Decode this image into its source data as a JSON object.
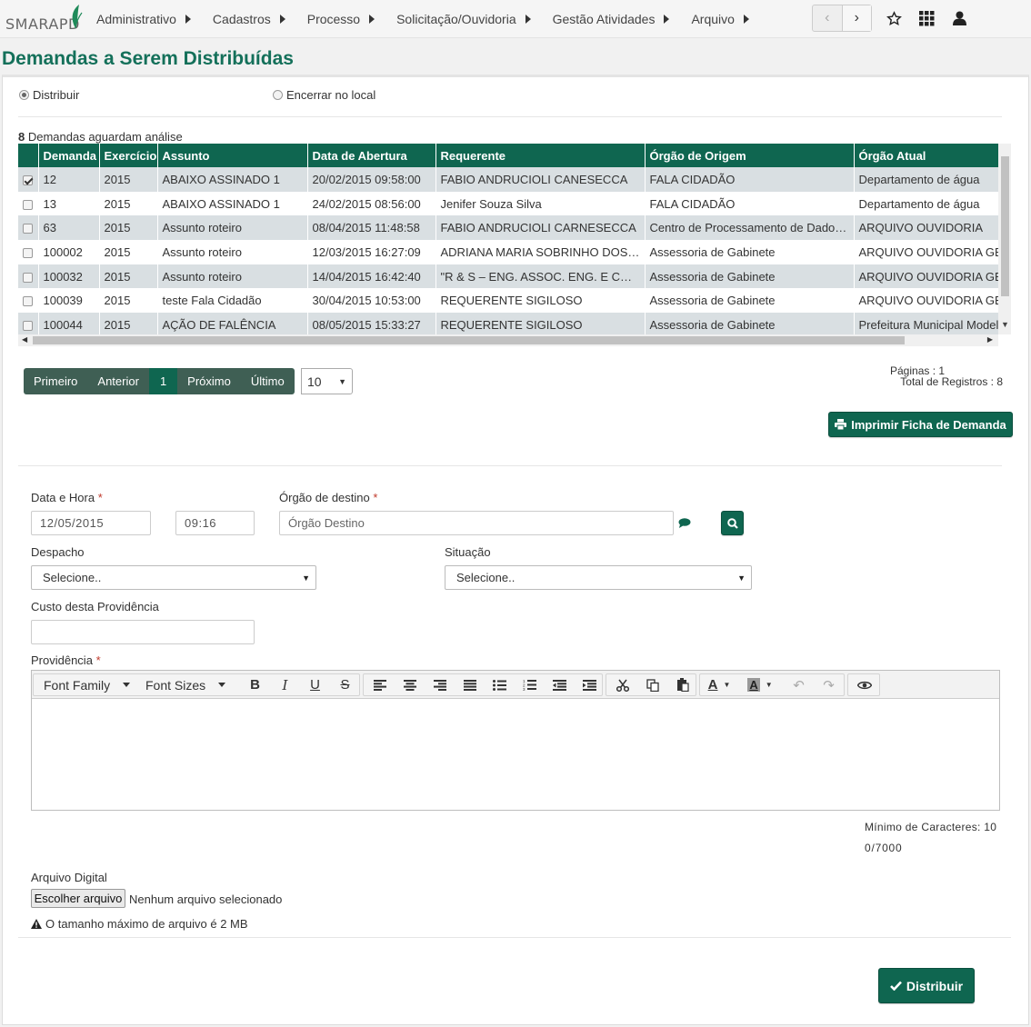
{
  "nav": {
    "logo": "SMARAPD",
    "menu": [
      "Administrativo",
      "Cadastros",
      "Processo",
      "Solicitação/Ouvidoria",
      "Gestão Atividades",
      "Arquivo"
    ]
  },
  "page": {
    "title": "Demandas a Serem Distribuídas"
  },
  "mode": {
    "options": [
      "Distribuir",
      "Encerrar no local"
    ],
    "selected": 0
  },
  "table": {
    "count": "8",
    "count_suffix": " Demandas aguardam análise",
    "columns": [
      "Demanda",
      "Exercício",
      "Assunto",
      "Data de Abertura",
      "Requerente",
      "Órgão de Origem",
      "Órgão Atual"
    ],
    "rows": [
      {
        "checked": true,
        "cells": [
          "12",
          "2015",
          "ABAIXO ASSINADO 1",
          "20/02/2015 09:58:00",
          "FABIO ANDRUCIOLI CANESECCA",
          "FALA CIDADÃO",
          "Departamento de água"
        ]
      },
      {
        "checked": false,
        "cells": [
          "13",
          "2015",
          "ABAIXO ASSINADO 1",
          "24/02/2015 08:56:00",
          "Jenifer Souza Silva",
          "FALA CIDADÃO",
          "Departamento de água"
        ]
      },
      {
        "checked": false,
        "cells": [
          "63",
          "2015",
          "Assunto roteiro",
          "08/04/2015 11:48:58",
          "FABIO ANDRUCIOLI CARNESECCA",
          "Centro de Processamento de Dados…",
          "ARQUIVO OUVIDORIA"
        ]
      },
      {
        "checked": false,
        "cells": [
          "100002",
          "2015",
          "Assunto roteiro",
          "12/03/2015 16:27:09",
          "ADRIANA MARIA SOBRINHO DOS SA…",
          "Assessoria de Gabinete",
          "ARQUIVO OUVIDORIA GERAL"
        ]
      },
      {
        "checked": false,
        "cells": [
          "100032",
          "2015",
          "Assunto roteiro",
          "14/04/2015 16:42:40",
          "\"R & S – ENG. ASSOC. ENG. E COME…",
          "Assessoria de Gabinete",
          "ARQUIVO OUVIDORIA GERAL"
        ]
      },
      {
        "checked": false,
        "cells": [
          "100039",
          "2015",
          "teste Fala Cidadão",
          "30/04/2015 10:53:00",
          "REQUERENTE SIGILOSO",
          "Assessoria de Gabinete",
          "ARQUIVO OUVIDORIA GERAL"
        ]
      },
      {
        "checked": false,
        "cells": [
          "100044",
          "2015",
          "AÇÃO DE FALÊNCIA",
          "08/05/2015 15:33:27",
          "REQUERENTE SIGILOSO",
          "Assessoria de Gabinete",
          "Prefeitura Municipal Modelo"
        ]
      }
    ]
  },
  "pager": {
    "first": "Primeiro",
    "prev": "Anterior",
    "current": "1",
    "next": "Próximo",
    "last": "Último",
    "page_size": "10",
    "pages_label": "Páginas : 1",
    "total_label": "Total de Registros : 8"
  },
  "print_button": "Imprimir Ficha de Demanda",
  "form": {
    "date_label": "Data e Hora",
    "date_value": "12/05/2015",
    "time_value": "09:16",
    "dest_label": "Órgão de destino",
    "dest_placeholder": "Órgão Destino",
    "despacho_label": "Despacho",
    "despacho_value": "Selecione..",
    "situacao_label": "Situação",
    "situacao_value": "Selecione..",
    "custo_label": "Custo desta Providência",
    "custo_value": "",
    "providencia_label": "Providência",
    "font_family": "Font Family",
    "font_sizes": "Font Sizes",
    "min_chars": "Mínimo de Caracteres: 10",
    "char_count": "0/7000",
    "file_label": "Arquivo Digital",
    "file_button": "Escolher arquivo",
    "file_status": "Nenhum arquivo selecionado",
    "file_warning": "O tamanho máximo de arquivo é 2 MB",
    "required_mark": "*"
  },
  "submit_button": "Distribuir",
  "colors": {
    "brand": "#0f6650",
    "required": "#c0392b"
  }
}
